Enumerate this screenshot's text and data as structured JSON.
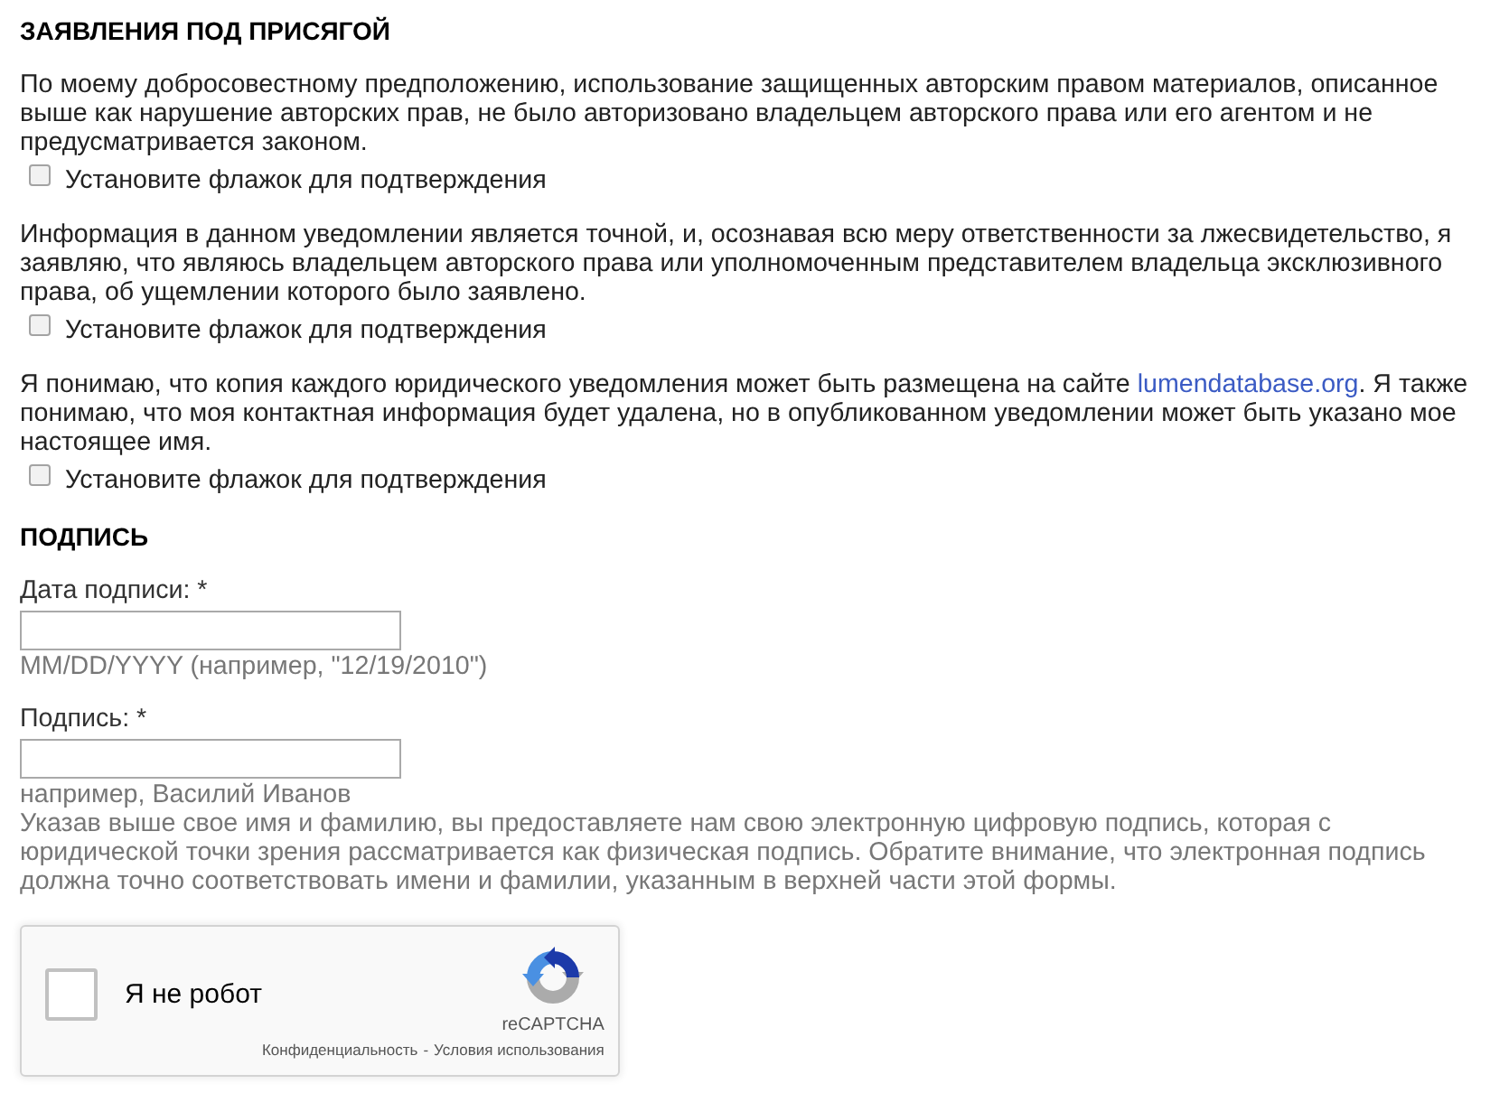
{
  "statements": {
    "heading": "ЗАЯВЛЕНИЯ ПОД ПРИСЯГОЙ",
    "items": [
      {
        "parts": [
          {
            "kind": "text",
            "text": "По моему добросовестному предположению, использование защищенных авторским правом материалов, описанное выше как нарушение авторских прав, не было авторизовано владельцем авторского права или его агентом и не предусматривается законом."
          }
        ],
        "confirm": {
          "label": "Установите флажок для подтверждения",
          "checked": false
        }
      },
      {
        "parts": [
          {
            "kind": "text",
            "text": "Информация в данном уведомлении является точной, и, осознавая всю меру ответственности за лжесвидетельство, я заявляю, что являюсь владельцем авторского права или уполномоченным представителем владельца эксклюзивного права, об ущемлении которого было заявлено."
          }
        ],
        "confirm": {
          "label": "Установите флажок для подтверждения",
          "checked": false
        }
      },
      {
        "parts": [
          {
            "kind": "text",
            "text": "Я понимаю, что копия каждого юридического уведомления может быть размещена на сайте "
          },
          {
            "kind": "link",
            "text": "lumendatabase.org"
          },
          {
            "kind": "text",
            "text": ". Я также понимаю, что моя контактная информация будет удалена, но в опубликованном уведомлении может быть указано мое настоящее имя."
          }
        ],
        "confirm": {
          "label": "Установите флажок для подтверждения",
          "checked": false
        }
      }
    ]
  },
  "signature": {
    "heading": "ПОДПИСЬ",
    "fields": [
      {
        "label": "Дата подписи: *",
        "hint": "MM/DD/YYYY (например, \"12/19/2010\")"
      },
      {
        "label": "Подпись: *",
        "hint": "например, Василий Иванов"
      }
    ],
    "note": "Указав выше свое имя и фамилию, вы предоставляете нам свою электронную цифровую подпись, которая с юридической точки зрения рассматривается как физическая подпись. Обратите внимание, что электронная подпись должна точно соответствовать имени и фамилии, указанным в верхней части этой формы."
  },
  "captcha": {
    "label": "Я не робот",
    "checked": false,
    "brand": "reCAPTCHA",
    "privacy": "Конфиденциальность",
    "separator": "-",
    "terms": "Условия использования"
  }
}
